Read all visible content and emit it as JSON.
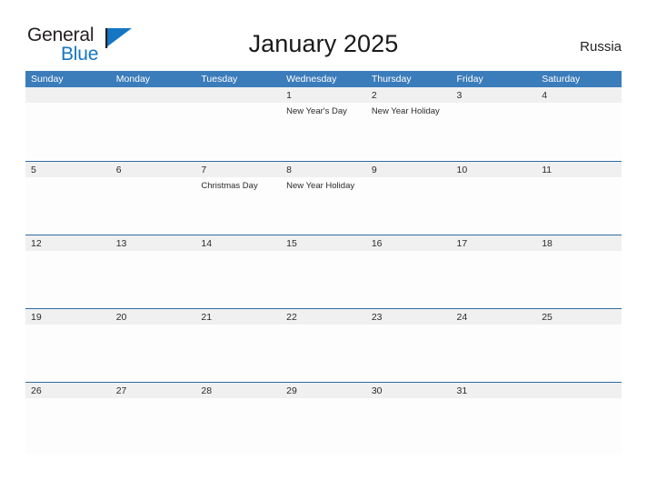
{
  "branding": {
    "word_1": "General",
    "word_2": "Blue",
    "flag_icon": "blue-triangle-flag-icon",
    "accent_color": "#1577c4"
  },
  "header": {
    "title": "January 2025",
    "region": "Russia",
    "header_bar_color": "#3b7cba",
    "row_divider_color": "#2e6ca4",
    "daynum_band_color": "#f0f0f0"
  },
  "weekdays": [
    "Sunday",
    "Monday",
    "Tuesday",
    "Wednesday",
    "Thursday",
    "Friday",
    "Saturday"
  ],
  "weeks": [
    {
      "days": [
        {
          "num": "",
          "events": []
        },
        {
          "num": "",
          "events": []
        },
        {
          "num": "",
          "events": []
        },
        {
          "num": "1",
          "events": [
            "New Year's Day"
          ]
        },
        {
          "num": "2",
          "events": [
            "New Year Holiday"
          ]
        },
        {
          "num": "3",
          "events": []
        },
        {
          "num": "4",
          "events": []
        }
      ]
    },
    {
      "days": [
        {
          "num": "5",
          "events": []
        },
        {
          "num": "6",
          "events": []
        },
        {
          "num": "7",
          "events": [
            "Christmas Day"
          ]
        },
        {
          "num": "8",
          "events": [
            "New Year Holiday"
          ]
        },
        {
          "num": "9",
          "events": []
        },
        {
          "num": "10",
          "events": []
        },
        {
          "num": "11",
          "events": []
        }
      ]
    },
    {
      "days": [
        {
          "num": "12",
          "events": []
        },
        {
          "num": "13",
          "events": []
        },
        {
          "num": "14",
          "events": []
        },
        {
          "num": "15",
          "events": []
        },
        {
          "num": "16",
          "events": []
        },
        {
          "num": "17",
          "events": []
        },
        {
          "num": "18",
          "events": []
        }
      ]
    },
    {
      "days": [
        {
          "num": "19",
          "events": []
        },
        {
          "num": "20",
          "events": []
        },
        {
          "num": "21",
          "events": []
        },
        {
          "num": "22",
          "events": []
        },
        {
          "num": "23",
          "events": []
        },
        {
          "num": "24",
          "events": []
        },
        {
          "num": "25",
          "events": []
        }
      ]
    },
    {
      "days": [
        {
          "num": "26",
          "events": []
        },
        {
          "num": "27",
          "events": []
        },
        {
          "num": "28",
          "events": []
        },
        {
          "num": "29",
          "events": []
        },
        {
          "num": "30",
          "events": []
        },
        {
          "num": "31",
          "events": []
        },
        {
          "num": "",
          "events": []
        }
      ]
    }
  ]
}
